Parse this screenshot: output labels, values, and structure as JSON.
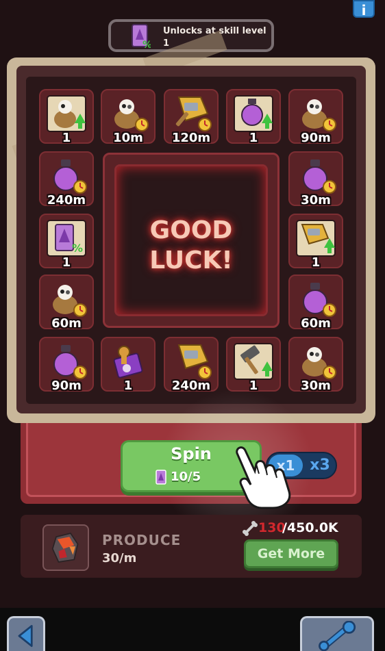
{
  "top": {
    "info_label": "i",
    "unlock_text_line1": "Unlocks at skill level",
    "unlock_text_line2": "1",
    "unlock_icon": "ticket-percent-icon"
  },
  "board": {
    "center_line1": "GOOD",
    "center_line2": "LUCK!",
    "cells": [
      {
        "icon": "cow-sack-upgrade-icon",
        "label": "1"
      },
      {
        "icon": "cow-sack-timer-icon",
        "label": "10m"
      },
      {
        "icon": "hammer-timer-icon",
        "label": "120m"
      },
      {
        "icon": "potion-upgrade-icon",
        "label": "1"
      },
      {
        "icon": "cow-sack-timer-icon",
        "label": "90m"
      },
      {
        "icon": "potion-timer-icon",
        "label": "240m"
      },
      {
        "icon": "potion-timer-icon",
        "label": "30m"
      },
      {
        "icon": "ticket-percent-icon",
        "label": "1"
      },
      {
        "icon": "hammer-upgrade-icon",
        "label": "1"
      },
      {
        "icon": "cow-sack-timer-icon",
        "label": "60m"
      },
      {
        "icon": "potion-timer-icon",
        "label": "60m"
      },
      {
        "icon": "potion-timer-icon",
        "label": "90m"
      },
      {
        "icon": "stamp-icon",
        "label": "1"
      },
      {
        "icon": "hammer-timer-icon",
        "label": "240m"
      },
      {
        "icon": "mallet-upgrade-icon",
        "label": "1"
      },
      {
        "icon": "cow-sack-timer-icon",
        "label": "30m"
      }
    ]
  },
  "spin": {
    "label": "Spin",
    "cost": "10/5",
    "cost_icon": "ticket-icon"
  },
  "multiplier": {
    "option1": "x1",
    "option2": "x3",
    "selected": "x1"
  },
  "produce": {
    "title": "PRODUCE",
    "rate": "30/m",
    "resource_icon": "ore-crystal-icon",
    "capacity_current": "130",
    "capacity_max": "/450.0K",
    "capacity_icon": "bone-icon",
    "get_more_label": "Get More"
  },
  "nav": {
    "back_icon": "back-arrow-icon",
    "tool_icon": "wrench-icon"
  },
  "colors": {
    "spin_green": "#79c863",
    "board_cell": "#5a2226",
    "capacity_red": "#d2282d",
    "accent_blue": "#3a8fd6"
  }
}
